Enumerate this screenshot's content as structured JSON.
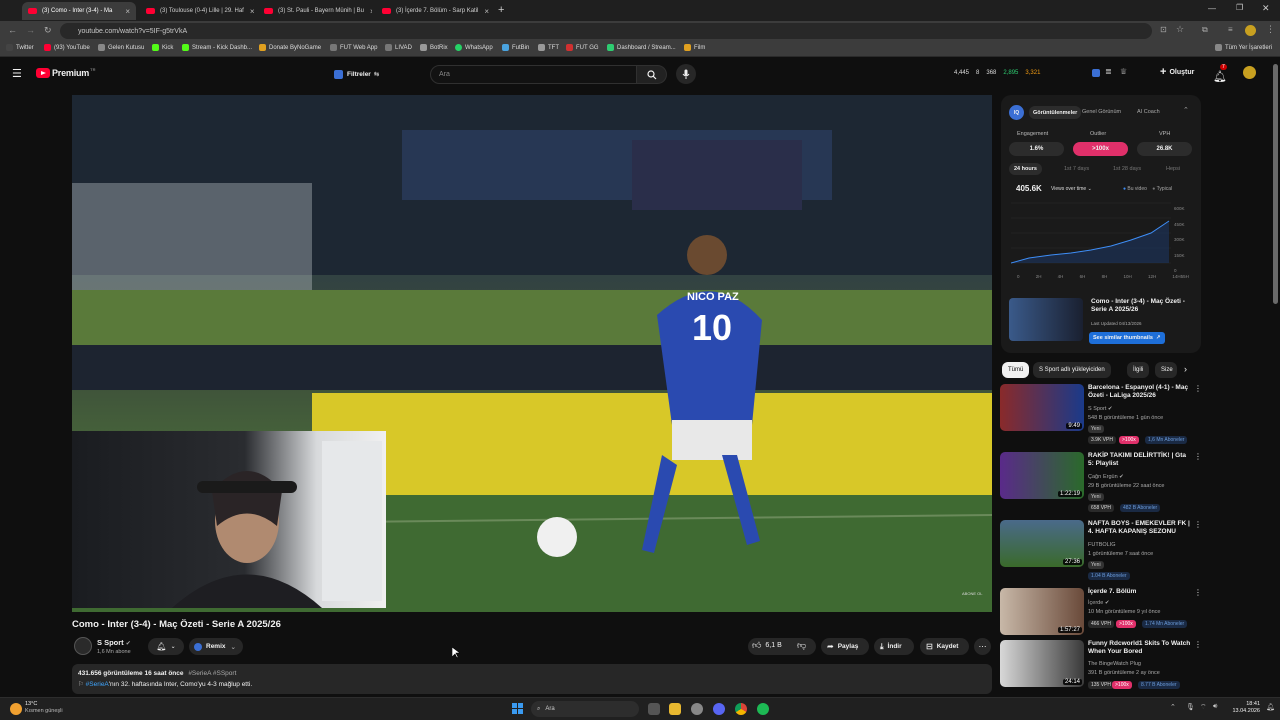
{
  "browser": {
    "tabs": [
      {
        "title": "(3) Como - Inter (3-4) - Ma",
        "active": true
      },
      {
        "title": "(3) Toulouse (0-4) Lille | 29. Haf",
        "active": false
      },
      {
        "title": "(3) St. Pauli - Bayern Münih | Bu",
        "active": false
      },
      {
        "title": "(3) İçerde 7. Bölüm - Sarp Katil",
        "active": false
      }
    ],
    "url": "youtube.com/watch?v=5IF-g5trVkA",
    "bookmarks": [
      "Twitter",
      "(93) YouTube",
      "Gelen Kutusu",
      "Kick",
      "Stream - Kick Dashb...",
      "Donate ByNoGame",
      "FUT Web App",
      "LIVAD",
      "BotRix",
      "WhatsApp",
      "FutBin",
      "TFT",
      "FUT GG",
      "Dashboard / Stream...",
      "Film"
    ],
    "all_bookmarks": "Tüm Yer İşaretleri"
  },
  "youtube": {
    "logo": "Premium",
    "logo_region": "TR",
    "filters": "Filtreler",
    "search_placeholder": "Ara",
    "stats": [
      "4,445",
      "8",
      "368",
      "2,895",
      "3,321"
    ],
    "create": "Oluştur",
    "notifications": "7"
  },
  "video": {
    "title": "Como - Inter (3-4) - Maç Özeti - Serie A 2025/26",
    "channel": "S Sport",
    "subscribers": "1,6 Mn abone",
    "remix": "Remix",
    "likes": "6,1 B",
    "share": "Paylaş",
    "download": "İndir",
    "save": "Kaydet",
    "desc_stats": "431.656 görüntüleme  16 saat önce",
    "desc_tags": "#SerieA #SSport",
    "desc_line2_tag": "#SerieA",
    "desc_line2": "'nın 32. haftasında Inter, Como'yu 4-3 mağlup etti."
  },
  "extension": {
    "tabs": [
      "Görüntülenmeler",
      "Genel Görünüm",
      "AI Coach"
    ],
    "metrics_labels": [
      "Engagement",
      "Outlier",
      "VPH"
    ],
    "metrics_values": [
      "1.6%",
      ">100x",
      "26.8K"
    ],
    "periods": [
      "24 hours",
      "1st 7 days",
      "1st 28 days",
      "Hepsi"
    ],
    "views": "405.6K",
    "views_over_time": "Views over time",
    "legend": [
      "Bu video",
      "Typical"
    ],
    "y_ticks": [
      "600K",
      "450K",
      "300K",
      "150K",
      "0"
    ],
    "x_ticks": [
      "0",
      "2H",
      "4H",
      "6H",
      "8H",
      "10H",
      "12H",
      "14H55H"
    ],
    "card_title": "Como - Inter (3-4) - Maç Özeti - Serie A 2025/26",
    "card_updated": "Last Updated 04/13/2026",
    "card_button": "See similar thumbnails"
  },
  "chips": [
    "Tümü",
    "S Sport adlı yükleyiciden",
    "İlgili",
    "Size"
  ],
  "recommendations": [
    {
      "title": "Barcelona - Espanyol (4-1) - Maç Özeti - LaLiga 2025/26",
      "channel": "S Sport",
      "meta": "548 B görüntüleme  1 gün önce",
      "new": "Yeni",
      "vph": "3.9K VPH",
      "outlier": ">100x",
      "subs": "1,6 Mn Aboneler",
      "duration": "9:49"
    },
    {
      "title": "RAKİP TAKIMI DELİRTTİK! | Gta 5: Playlist",
      "channel": "Çağrı Ergün",
      "meta": "29 B görüntüleme  22 saat önce",
      "new": "Yeni",
      "vph": "658 VPH",
      "outlier": "",
      "subs": "482 B Aboneler",
      "duration": "1:22:19"
    },
    {
      "title": "NAFTA BOYS - EMEKEVLER FK | 4. HAFTA KAPANIŞ SEZONU",
      "channel": "FUTBOLIG",
      "meta": "1 görüntüleme  7 saat önce",
      "new": "Yeni",
      "vph": "",
      "outlier": "",
      "subs": "1.04 B Aboneler",
      "duration": "27:36"
    },
    {
      "title": "İçerde 7. Bölüm",
      "channel": "İçerde",
      "meta": "10 Mn görüntüleme  9 yıl önce",
      "new": "",
      "vph": "466 VPH",
      "outlier": ">100x",
      "subs": "1.74 Mn Aboneler",
      "duration": "1:57:27"
    },
    {
      "title": "Funny Rdcworld1 Skits To Watch When Your Bored",
      "channel": "The BingeWatch Plug",
      "meta": "391 B görüntüleme  2 ay önce",
      "new": "",
      "vph": "135 VPH",
      "outlier": ">100x",
      "subs": "8.77 B Aboneler",
      "duration": "24:14"
    }
  ],
  "taskbar": {
    "weather_temp": "13°C",
    "weather_desc": "Kısmen güneşli",
    "search": "Ara",
    "time": "18:41",
    "date": "13.04.2026"
  },
  "overlay": {
    "jersey_name": "NICO PAZ",
    "jersey_number": "10",
    "watermark": "ABONE OL"
  }
}
